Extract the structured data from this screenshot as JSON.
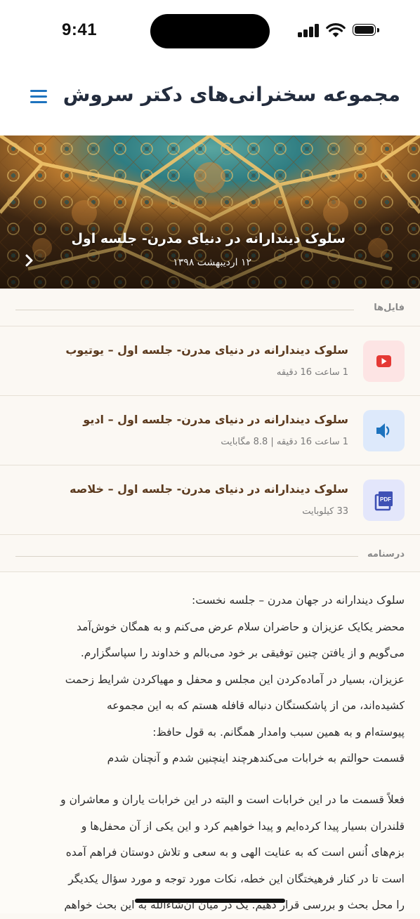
{
  "status_bar": {
    "time": "9:41"
  },
  "header": {
    "title": "مجموعه سخنرانی‌های دکتر سروش",
    "menu_icon": "hamburger-menu-icon"
  },
  "hero": {
    "title": "سلوک دیندارانه در دنیای مدرن- جلسه اول",
    "date": "۱۲ اردیبهشت ۱۳۹۸",
    "next_icon": "chevron-right-icon"
  },
  "files_section": {
    "label": "فایل‌ها",
    "items": [
      {
        "icon": "youtube-icon",
        "title": "سلوک دیندارانه در دنیای مدرن- جلسه اول – یوتیوب",
        "meta": "1 ساعت 16 دقیقه",
        "icon_color": "#e53935",
        "icon_bg": "#fde4e4"
      },
      {
        "icon": "audio-icon",
        "title": "سلوک دیندارانه در دنیای مدرن- جلسه اول – ادیو",
        "meta": "1 ساعت 16 دقیقه | 8.8 مگابایت",
        "icon_color": "#1e73be",
        "icon_bg": "#dde9fb"
      },
      {
        "icon": "pdf-icon",
        "title": "سلوک دیندارانه در دنیای مدرن- جلسه اول – خلاصه",
        "meta": "33 کیلوبایت",
        "icon_color": "#3f51b5",
        "icon_bg": "#e3e6fb"
      }
    ]
  },
  "transcript_section": {
    "label": "درسنامه",
    "paragraph1": [
      "سلوک دیندارانه در جهان مدرن – جلسه نخست:",
      "محضر یکایک عزیزان و حاضران سلام عرض می‌کنم و به همگان خوش‌آمد",
      "می‌گویم و از یافتن چنین توفیقی بر خود می‌بالم و خداوند را سپاسگزارم.",
      "عزیزان، بسیار در آماده‌کردن این مجلس و محفل و مهیاکردن شرایط زحمت",
      "کشیده‌اند، من از پاشکستگان دنباله قافله هستم که به این مجموعه",
      "پیوسته‌ام و به همین سبب وامدار همگانم. به قول حافظ:",
      "قسمت حوالتم به خرابات می‌کندهرچند اینچنین شدم و آنچنان شدم"
    ],
    "paragraph2": [
      "فعلاً قسمت ما در این خرابات است و البته در این خرابات یاران و معاشران و",
      "قلندران بسیار پیدا کرده‌ایم و پیدا خواهیم کرد و این یکی از آن محفل‌ها و",
      "بزم‌های اُنس است که به عنایت الهی و به سعی و تلاش دوستان فراهم آمده",
      "است تا در کنار فرهیختگان این خطه، نکات مورد توجه و مورد سؤال یکدیگر",
      "را محل بحث و بررسی قرار دهیم. یک در میان ان‌شاءالله به این بحث خواهم"
    ]
  },
  "colors": {
    "accent": "#1e73be",
    "file_title": "#5b3a1e",
    "background": "#fbf8f3"
  }
}
